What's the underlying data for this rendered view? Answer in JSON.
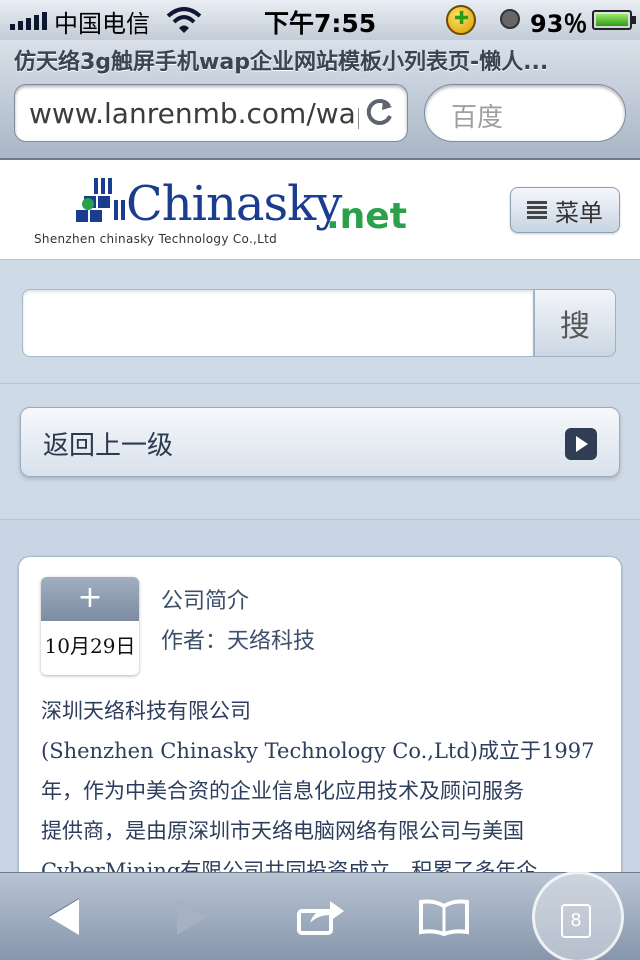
{
  "status_bar": {
    "carrier": "中国电信",
    "time": "下午7:55",
    "battery": "93％",
    "battery_level": 0.93,
    "icons": [
      "signal-icon",
      "wifi-icon",
      "security-shield-icon",
      "alarm-clock-icon",
      "battery-icon"
    ]
  },
  "browser": {
    "page_title": "仿天络3g触屏手机wap企业网站模板小列表页-懒人...",
    "url": "www.lanrenmb.com/wap",
    "search_placeholder": "百度"
  },
  "site": {
    "logo_word": "Chinasky",
    "logo_net": ".net",
    "logo_sub": "Shenzhen chinasky Technology Co.,Ltd",
    "menu_label": "菜单",
    "search_button_label": "搜",
    "back_label": "返回上一级"
  },
  "article": {
    "badge_plus": "+",
    "date": "10月29日",
    "title": "公司简介",
    "author": "作者：天络科技",
    "body_line_1": "深圳天络科技有限公司",
    "body_line_2": "(Shenzhen Chinasky Technology Co.,Ltd)成立于1997",
    "body_line_3": "年，作为中美合资的企业信息化应用技术及顾问服务",
    "body_line_4": "提供商，是由原深圳市天络电脑网络有限公司与美国",
    "body_line_5": "CyberMining有限公司共同投资成立，积累了多年企"
  },
  "toolbar": {
    "tabs_count": "8",
    "icons": [
      "back-arrow-icon",
      "forward-arrow-icon",
      "share-icon",
      "bookmarks-icon",
      "tabs-icon"
    ]
  },
  "colors": {
    "accent": "#1a3d8f",
    "net_green": "#2aa04a",
    "panel": "#cfdae7",
    "text": "#2d3f5c"
  }
}
